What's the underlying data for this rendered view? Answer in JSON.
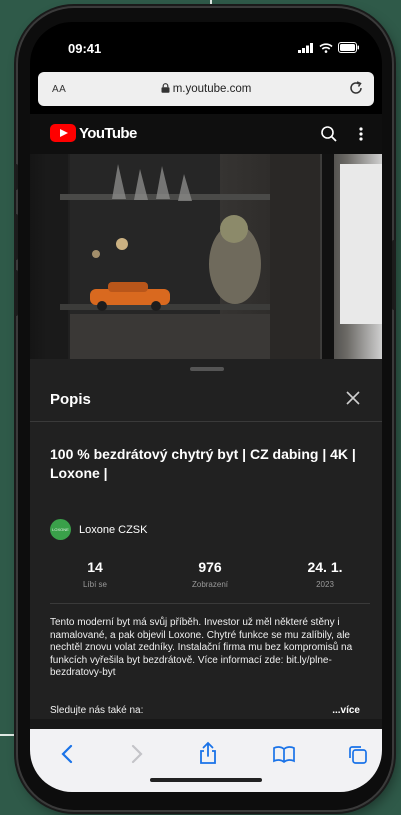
{
  "status_bar": {
    "time": "09:41"
  },
  "browser": {
    "text_size_label": "AA",
    "url": "m.youtube.com"
  },
  "youtube": {
    "brand": "YouTube"
  },
  "panel": {
    "title": "Popis",
    "video_title": "100 % bezdrátový chytrý byt | CZ dabing | 4K | Loxone |",
    "channel": {
      "name": "Loxone CZSK",
      "avatar_text": "LOXONE"
    },
    "stats": [
      {
        "value": "14",
        "label": "Líbí se"
      },
      {
        "value": "976",
        "label": "Zobrazení"
      },
      {
        "value": "24. 1.",
        "label": "2023"
      }
    ],
    "description": "Tento moderní byt má svůj příběh. Investor už měl některé stěny i namalované, a pak objevil Loxone. Chytré funkce se mu zalíbily, ale nechtěl znovu volat zedníky. Instalační firma mu bez kompromisů na funkcích vyřešila byt bezdrátově. Více informací zde: bit.ly/plne-bezdratovy-byt",
    "follow": "Sledujte nás také na:",
    "more": "...více"
  },
  "icons": {
    "lock": "lock-icon",
    "reload": "reload-icon",
    "search": "search-icon",
    "more": "more-vert-icon",
    "close": "close-icon",
    "back": "chevron-left-icon",
    "forward": "chevron-right-icon",
    "share": "share-icon",
    "bookmarks": "book-icon",
    "tabs": "tabs-icon"
  },
  "colors": {
    "background": "#2f5a49",
    "youtube_red": "#ff0000",
    "ios_blue": "#1a73e8",
    "panel": "#212121",
    "avatar": "#3aa14a"
  }
}
